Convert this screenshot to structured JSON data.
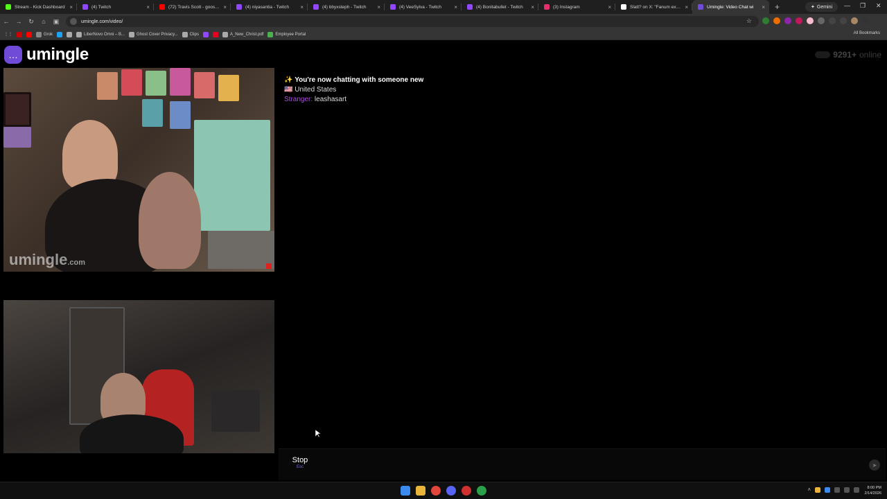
{
  "browser": {
    "tabs": [
      {
        "label": "Stream - Kick Dashboard",
        "color": "#53fc18",
        "active": false
      },
      {
        "label": "(4) Twitch",
        "color": "#9146ff",
        "active": false
      },
      {
        "label": "(72) Travis Scott - goosebum",
        "color": "#ff0000",
        "active": false
      },
      {
        "label": "(4) niyasantia - Twitch",
        "color": "#9146ff",
        "active": false
      },
      {
        "label": "(4) bbyxsteph - Twitch",
        "color": "#9146ff",
        "active": false
      },
      {
        "label": "(4) VeeSylva - Twitch",
        "color": "#9146ff",
        "active": false
      },
      {
        "label": "(4) Bonitabullet - Twitch",
        "color": "#9146ff",
        "active": false
      },
      {
        "label": "(3) Instagram",
        "color": "#e1306c",
        "active": false
      },
      {
        "label": "Slatt? on X: \"Fanum expose",
        "color": "#ffffff",
        "active": false
      },
      {
        "label": "Umingle: Video Chat wi",
        "color": "#6f4bd8",
        "active": true
      }
    ],
    "new_tab_label": "+",
    "gemini_label": "Gemini",
    "window_controls": [
      "—",
      "❐",
      "✕"
    ],
    "url": "umingle.com/video/",
    "bookmarks": [
      {
        "label": "",
        "color": "#cc0000"
      },
      {
        "label": "",
        "color": "#ff0000"
      },
      {
        "label": "Grok",
        "color": "#888888"
      },
      {
        "label": "",
        "color": "#1da1f2"
      },
      {
        "label": "",
        "color": "#aaaaaa"
      },
      {
        "label": "LiberNovo Omni – B...",
        "color": "#aaaaaa"
      },
      {
        "label": "Ghost Cover Privacy...",
        "color": "#aaaaaa"
      },
      {
        "label": "Clips",
        "color": "#aaaaaa"
      },
      {
        "label": "",
        "color": "#9146ff"
      },
      {
        "label": "",
        "color": "#e60023"
      },
      {
        "label": "A_New_Christ.pdf",
        "color": "#aaaaaa"
      },
      {
        "label": "Employee Portal",
        "color": "#4caf50"
      }
    ],
    "all_bookmarks_label": "All Bookmarks"
  },
  "app": {
    "logo_text": "umingle",
    "online_count": "9291+",
    "online_label": "online",
    "watermark_main": "umingle",
    "watermark_suffix": ".com",
    "chat": {
      "system_message": "You're now chatting with someone new",
      "country": "United States",
      "stranger_label": "Stranger:",
      "stranger_name": "leashasart"
    },
    "stop_label": "Stop",
    "stop_shortcut": "Esc",
    "message_placeholder": ""
  },
  "taskbar": {
    "time": "8:00 PM",
    "date": "2/14/2026"
  },
  "colors": {
    "accent": "#6f4bd8",
    "stranger": "#a94fe0"
  },
  "icons": [
    "search-icon",
    "star-icon",
    "send-icon",
    "sparkle-icon",
    "us-flag-icon",
    "windows-start-icon"
  ]
}
